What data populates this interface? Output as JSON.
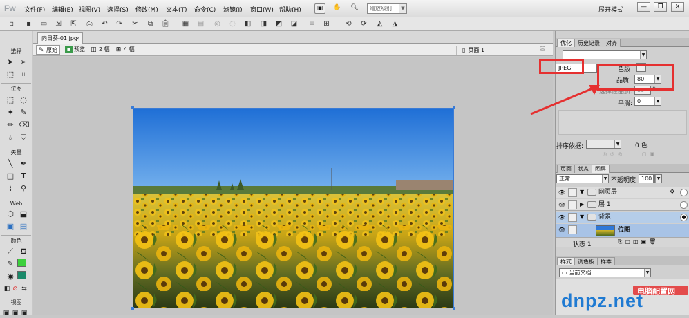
{
  "app": {
    "logo": "Fw"
  },
  "menu": [
    "文件(F)",
    "编辑(E)",
    "视图(V)",
    "选择(S)",
    "修改(M)",
    "文本(T)",
    "命令(C)",
    "滤镜(I)",
    "窗口(W)",
    "帮助(H)"
  ],
  "zoom_placeholder": "缩放级别",
  "mode": "展开模式",
  "document": {
    "tab_name": "向日葵-01.jpg",
    "page": "页面 1"
  },
  "view_buttons": {
    "original": "原始",
    "preview": "预览",
    "two_up": "2 幅",
    "four_up": "4 幅"
  },
  "tools": {
    "select": "选择",
    "bitmap": "位图",
    "vector": "矢量",
    "web": "Web",
    "colors": "颜色",
    "view": "视图"
  },
  "optimize_panel": {
    "tabs": [
      "优化",
      "历史记录",
      "对齐"
    ],
    "format": "JPEG",
    "matte_label": "色版",
    "quality_label": "品质:",
    "quality_value": "80",
    "selective_quality_label": "选择性品质:",
    "selective_quality_value": "80",
    "smoothing_label": "平滑:",
    "smoothing_value": "0",
    "sort_label": "排序依据:",
    "colors_count": "0 色"
  },
  "layers_panel": {
    "tabs": [
      "页面",
      "状态",
      "图层"
    ],
    "blend_mode": "正常",
    "opacity_label": "不透明度",
    "opacity_value": "100",
    "layers": [
      {
        "name": "网页层"
      },
      {
        "name": "层 1"
      },
      {
        "name": "背景"
      },
      {
        "name": "位图"
      }
    ],
    "status": "状态 1"
  },
  "styles_panel": {
    "tabs": [
      "样式",
      "调色板",
      "样本"
    ],
    "source": "当前文档"
  },
  "watermark": {
    "title": "电脑配置网",
    "brand": "dnpz.net"
  },
  "colors": {
    "highlight": "#e53030",
    "accent": "#3a7bd5",
    "stroke_swatch": "#00b050"
  }
}
